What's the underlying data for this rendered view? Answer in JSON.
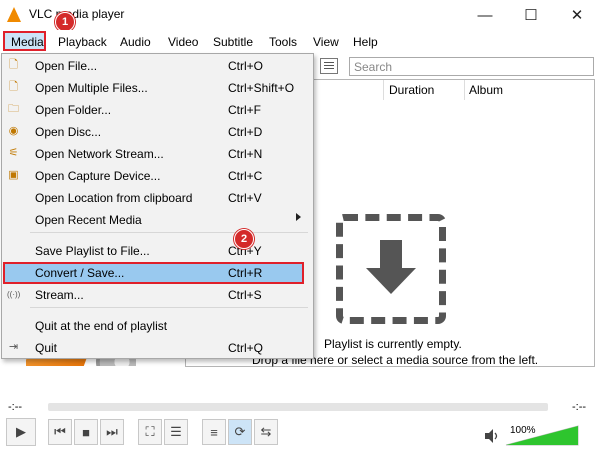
{
  "window": {
    "title": "VLC media player",
    "minimize_glyph": "—",
    "maximize_glyph": "☐",
    "close_glyph": "✕"
  },
  "menubar": [
    "Media",
    "Playback",
    "Audio",
    "Video",
    "Subtitle",
    "Tools",
    "View",
    "Help"
  ],
  "annotations": {
    "badge1": "1",
    "badge2": "2",
    "highlight_color": "#e0202a"
  },
  "media_menu": [
    {
      "label": "Open File...",
      "shortcut": "Ctrl+O",
      "icon": "file-icon"
    },
    {
      "label": "Open Multiple Files...",
      "shortcut": "Ctrl+Shift+O",
      "icon": "files-icon"
    },
    {
      "label": "Open Folder...",
      "shortcut": "Ctrl+F",
      "icon": "folder-icon"
    },
    {
      "label": "Open Disc...",
      "shortcut": "Ctrl+D",
      "icon": "disc-icon"
    },
    {
      "label": "Open Network Stream...",
      "shortcut": "Ctrl+N",
      "icon": "network-icon"
    },
    {
      "label": "Open Capture Device...",
      "shortcut": "Ctrl+C",
      "icon": "capture-icon"
    },
    {
      "label": "Open Location from clipboard",
      "shortcut": "Ctrl+V",
      "icon": ""
    },
    {
      "label": "Open Recent Media",
      "shortcut": "",
      "icon": ""
    },
    {
      "label": "Save Playlist to File...",
      "shortcut": "Ctrl+Y",
      "icon": ""
    },
    {
      "label": "Convert / Save...",
      "shortcut": "Ctrl+R",
      "icon": ""
    },
    {
      "label": "Stream...",
      "shortcut": "Ctrl+S",
      "icon": "stream-icon"
    },
    {
      "label": "Quit at the end of playlist",
      "shortcut": "",
      "icon": ""
    },
    {
      "label": "Quit",
      "shortcut": "Ctrl+Q",
      "icon": "quit-icon"
    }
  ],
  "playlist": {
    "search_placeholder": "Search",
    "columns": [
      "Duration",
      "Album"
    ],
    "empty_line1": "Playlist is currently empty.",
    "empty_line2": "Drop a file here or select a media source from the left."
  },
  "player": {
    "time_elapsed": "-:--",
    "time_total": "-:--",
    "volume_label": "100%",
    "volume_level": 1.0,
    "volume_color": "#2ec52e"
  }
}
